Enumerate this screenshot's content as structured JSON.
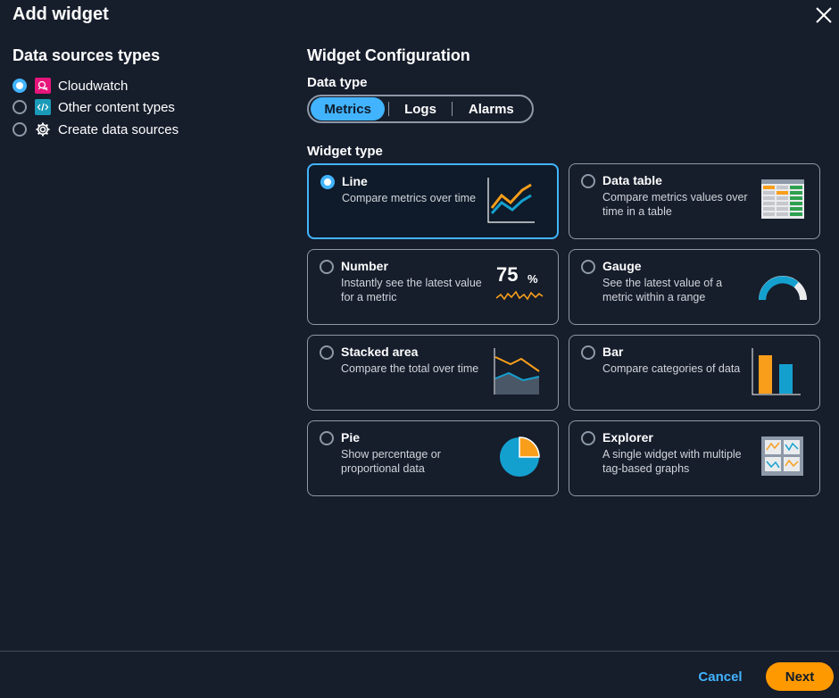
{
  "header": {
    "title": "Add widget"
  },
  "data_sources": {
    "title": "Data sources types",
    "items": [
      {
        "label": "Cloudwatch",
        "icon": "cloudwatch-icon",
        "checked": true
      },
      {
        "label": "Other content types",
        "icon": "code-icon",
        "checked": false
      },
      {
        "label": "Create data sources",
        "icon": "gear-icon",
        "checked": false
      }
    ]
  },
  "config": {
    "title": "Widget Configuration",
    "data_type_label": "Data type",
    "data_types": [
      "Metrics",
      "Logs",
      "Alarms"
    ],
    "data_type_selected": "Metrics",
    "widget_type_label": "Widget type",
    "widgets": [
      {
        "title": "Line",
        "desc": "Compare metrics over time",
        "selected": true
      },
      {
        "title": "Data table",
        "desc": "Compare metrics values over time in a table",
        "selected": false
      },
      {
        "title": "Number",
        "desc": "Instantly see the latest value for a metric",
        "selected": false,
        "illus_value": "75",
        "illus_unit": "%"
      },
      {
        "title": "Gauge",
        "desc": "See the latest value of a metric within a range",
        "selected": false
      },
      {
        "title": "Stacked area",
        "desc": "Compare the total over time",
        "selected": false
      },
      {
        "title": "Bar",
        "desc": "Compare categories of data",
        "selected": false
      },
      {
        "title": "Pie",
        "desc": "Show percentage or proportional data",
        "selected": false
      },
      {
        "title": "Explorer",
        "desc": "A single widget with multiple tag-based graphs",
        "selected": false
      }
    ]
  },
  "footer": {
    "cancel_label": "Cancel",
    "next_label": "Next"
  },
  "colors": {
    "accent": "#42b4ff",
    "primary": "#ff9900",
    "chart_orange": "#f89e1b",
    "chart_blue": "#14a0cf"
  }
}
